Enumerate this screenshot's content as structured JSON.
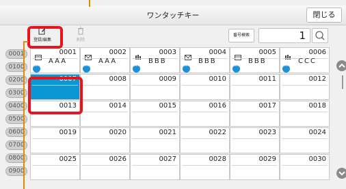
{
  "title": "ワンタッチキー",
  "close_label": "閉じる",
  "toolbar": {
    "register_label": "登録/編集",
    "delete_label": "削除",
    "search_label": "番号検索",
    "search_value": "1"
  },
  "row_labels": [
    "0001",
    "0100",
    "0200",
    "0300",
    "0400",
    "0500",
    "0600",
    "0700",
    "0800",
    "0900"
  ],
  "cells": [
    {
      "num": "0001",
      "type": "fax",
      "name": "AAA",
      "badge": true
    },
    {
      "num": "0002",
      "type": "mail",
      "name": "AAA",
      "badge": true
    },
    {
      "num": "0003",
      "type": "group",
      "name": "BBB",
      "badge": true
    },
    {
      "num": "0004",
      "type": "mail",
      "name": "BBB",
      "badge": true
    },
    {
      "num": "0005",
      "type": "fax",
      "name": "BBB",
      "badge": true
    },
    {
      "num": "0006",
      "type": "group",
      "name": "CCC",
      "badge": true
    },
    {
      "num": "0007",
      "type": "",
      "name": "",
      "badge": false,
      "selected": true
    },
    {
      "num": "0008",
      "type": "",
      "name": "",
      "badge": false
    },
    {
      "num": "0009",
      "type": "",
      "name": "",
      "badge": false
    },
    {
      "num": "0010",
      "type": "",
      "name": "",
      "badge": false
    },
    {
      "num": "0011",
      "type": "",
      "name": "",
      "badge": false
    },
    {
      "num": "0012",
      "type": "",
      "name": "",
      "badge": false
    },
    {
      "num": "0013",
      "type": "",
      "name": "",
      "badge": false
    },
    {
      "num": "0014",
      "type": "",
      "name": "",
      "badge": false
    },
    {
      "num": "0015",
      "type": "",
      "name": "",
      "badge": false
    },
    {
      "num": "0016",
      "type": "",
      "name": "",
      "badge": false
    },
    {
      "num": "0017",
      "type": "",
      "name": "",
      "badge": false
    },
    {
      "num": "0018",
      "type": "",
      "name": "",
      "badge": false
    },
    {
      "num": "0019",
      "type": "",
      "name": "",
      "badge": false
    },
    {
      "num": "0020",
      "type": "",
      "name": "",
      "badge": false
    },
    {
      "num": "0021",
      "type": "",
      "name": "",
      "badge": false
    },
    {
      "num": "0022",
      "type": "",
      "name": "",
      "badge": false
    },
    {
      "num": "0023",
      "type": "",
      "name": "",
      "badge": false
    },
    {
      "num": "0024",
      "type": "",
      "name": "",
      "badge": false
    },
    {
      "num": "0025",
      "type": "",
      "name": "",
      "badge": false
    },
    {
      "num": "0026",
      "type": "",
      "name": "",
      "badge": false
    },
    {
      "num": "0027",
      "type": "",
      "name": "",
      "badge": false
    },
    {
      "num": "0028",
      "type": "",
      "name": "",
      "badge": false
    },
    {
      "num": "0029",
      "type": "",
      "name": "",
      "badge": false
    },
    {
      "num": "0030",
      "type": "",
      "name": "",
      "badge": false
    }
  ],
  "colors": {
    "selected": "#0b96d4",
    "highlight": "#e8131b",
    "callout": "#e08a00",
    "badge": "#1e90d8"
  }
}
